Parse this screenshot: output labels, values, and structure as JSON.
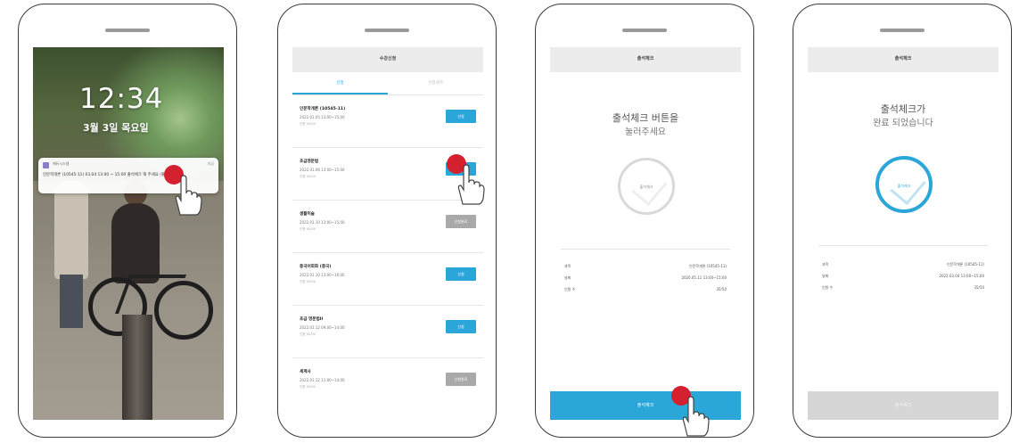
{
  "phone1": {
    "lock_time": "12:34",
    "lock_date": "3월 3일 목요일",
    "notification": {
      "app_name": "에듀시스템",
      "time_ago": "지금",
      "message": "인문학개론 (10545-11) 03.04 13:00 ~ 15:00 출석체크 해 주세요 (출석 마감 전)"
    }
  },
  "phone2": {
    "title": "수강신청",
    "tabs": [
      "신청",
      "신청내역"
    ],
    "active_tab": 0,
    "courses": [
      {
        "name": "인문학개론 (10545-11)",
        "when": "2022.01.05 13:00~15:00",
        "sub": "인원 00/00",
        "button": "신청",
        "status": "open"
      },
      {
        "name": "초급영문법",
        "when": "2022.01.06 13:00~15:00",
        "sub": "인원 00/00",
        "button": "신청",
        "status": "open"
      },
      {
        "name": "생활미술",
        "when": "2022.01.10 13:00~15:00",
        "sub": "인원 00/00",
        "button": "신청완료",
        "status": "done"
      },
      {
        "name": "중국어회화 (중국)",
        "when": "2022.01.10 13:00~16:00",
        "sub": "인원 00/00",
        "button": "신청",
        "status": "open"
      },
      {
        "name": "초급 영문법II",
        "when": "2022.01.12 09:00~14:00",
        "sub": "인원 00/00",
        "button": "신청",
        "status": "open"
      },
      {
        "name": "세계사",
        "when": "2022.01.12 11:00~14:00",
        "sub": "인원 00/00",
        "button": "신청완료",
        "status": "done"
      }
    ]
  },
  "phone3": {
    "title": "출석체크",
    "prompt_line1": "출석체크 버튼을",
    "prompt_line2": "눌러주세요",
    "circle_label": "출석체크",
    "info": [
      {
        "key": "과목",
        "value": "인문학개론 (10545-11)"
      },
      {
        "key": "날짜",
        "value": "2020.05.11 13:00~15:00"
      },
      {
        "key": "인원 수",
        "value": "35/50"
      }
    ],
    "bottom_button": "출석체크"
  },
  "phone4": {
    "title": "출석체크",
    "prompt_line1": "출석체크가",
    "prompt_line2": "완료 되었습니다",
    "circle_label": "출석체크",
    "info": [
      {
        "key": "과목",
        "value": "인문학개론 (10545-11)"
      },
      {
        "key": "날짜",
        "value": "2022.03.04 13:00~15:00"
      },
      {
        "key": "인원 수",
        "value": "35/50"
      }
    ],
    "bottom_button": "출석체크"
  },
  "colors": {
    "accent": "#2ba6d9",
    "done": "#a9a9a9",
    "tap_dot": "#d5202f",
    "disabled_button": "#d6d6d6"
  }
}
